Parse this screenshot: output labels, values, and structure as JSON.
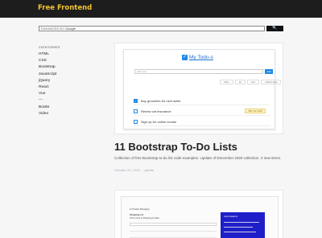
{
  "header": {
    "brand": "Free Frontend"
  },
  "search": {
    "placeholder_prefix": "ENHANCED BY",
    "placeholder_brand": "Google",
    "button_label": "🔍"
  },
  "sidebar": {
    "heading": "CATEGORIES",
    "items": [
      "HTML",
      "CSS",
      "Bootstrap",
      "JavaScript",
      "jQuery",
      "React",
      "Vue",
      "—",
      "Books",
      "Video"
    ]
  },
  "post": {
    "title": "11 Bootstrap To-Do Lists",
    "description": "Collection of free Bootstrap to-do list code examples. Update of December 2020 collection. 2 new items.",
    "meta": "October 20, 2021 · update"
  },
  "preview1": {
    "title": "My Todo-s",
    "input_placeholder": "Add new...",
    "add_label": "Add",
    "filters": [
      "Filter",
      "All",
      "Sort",
      "Added date"
    ],
    "items": [
      {
        "text": "Buy groceries for next week",
        "done": true,
        "due": ""
      },
      {
        "text": "Renew car insurance",
        "done": false,
        "due": "28th Jun 2020"
      },
      {
        "text": "Sign up for online course",
        "done": false,
        "due": ""
      }
    ]
  },
  "preview2": {
    "heading": "Js Product Managing",
    "sub1": "Shopping List",
    "sub2": "This is how to Shopping by date",
    "side_title": "Lists Headers",
    "colors": {
      "panel": "#1f1fc9"
    }
  },
  "colors": {
    "brand": "#f3c430",
    "topbar": "#1d1d1d",
    "accent": "#1e88e5"
  }
}
